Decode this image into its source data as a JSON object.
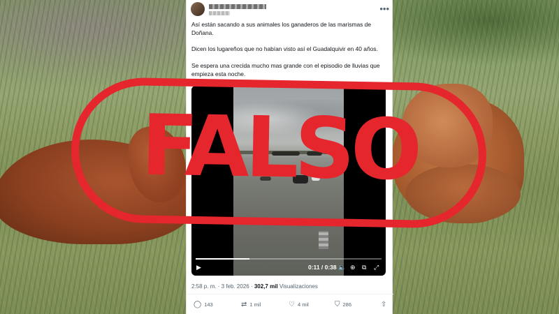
{
  "tweet": {
    "text1": "Así están sacando a sus animales los ganaderos de las marismas de Doñana.",
    "text2": "Dicen los lugareños que no habían visto así el Guadalquivir en 40 años.",
    "text3": "Se espera una crecida mucho mas grande con el episodio de lluvias que empieza esta noche.",
    "video": {
      "time": "0:11 / 0:38",
      "progress_fraction": 0.29
    },
    "meta": {
      "datetime": "2:58 p. m. · 3 feb. 2026 ·",
      "views_count": "302,7 mil",
      "views_label": "Visualizaciones"
    },
    "actions": {
      "replies": "143",
      "reposts": "1 mil",
      "likes": "4 mil",
      "bookmarks": "286"
    }
  },
  "stamp": {
    "label": "FALSO",
    "color": "#e5262c"
  },
  "icons": [
    "more-icon",
    "play-icon",
    "volume-icon",
    "captions-icon",
    "pip-icon",
    "fullscreen-icon",
    "reply-icon",
    "repost-icon",
    "like-icon",
    "bookmark-icon",
    "share-icon"
  ]
}
